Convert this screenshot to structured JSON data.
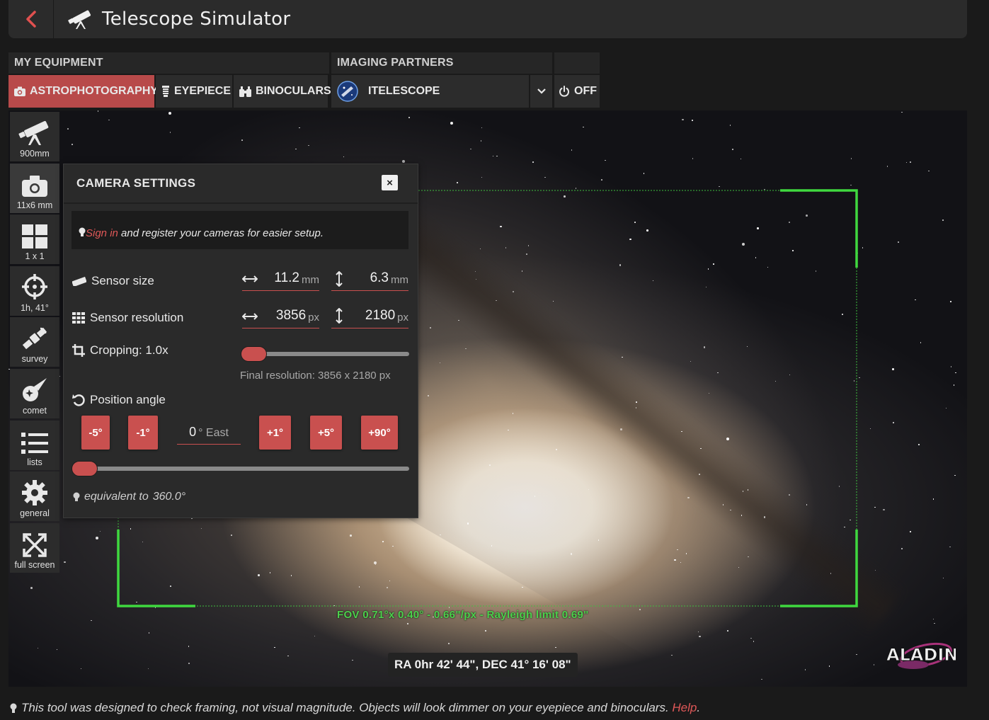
{
  "header": {
    "title": "Telescope Simulator",
    "back_icon": "chevron-left-icon",
    "app_icon": "telescope-icon",
    "accent": "#d9534f"
  },
  "equipment": {
    "my_equipment_label": "MY EQUIPMENT",
    "partners_label": "IMAGING PARTNERS",
    "tabs": [
      {
        "label": "ASTROPHOTOGRAPHY",
        "icon": "camera-icon",
        "active": true
      },
      {
        "label": "EYEPIECE",
        "icon": "eyepiece-icon",
        "active": false
      },
      {
        "label": "BINOCULARS",
        "icon": "binoculars-icon",
        "active": false
      }
    ],
    "partner": {
      "label": "ITELESCOPE",
      "icon": "itelescope-logo"
    },
    "off_label": "OFF"
  },
  "tools": [
    {
      "label": "900mm",
      "icon": "telescope-icon"
    },
    {
      "label": "11x6 mm",
      "icon": "camera-icon"
    },
    {
      "label": "1 x 1",
      "icon": "grid-icon"
    },
    {
      "label": "1h, 41°",
      "icon": "crosshair-icon"
    },
    {
      "label": "survey",
      "icon": "satellite-icon"
    },
    {
      "label": "comet",
      "icon": "comet-icon"
    },
    {
      "label": "lists",
      "icon": "list-icon"
    },
    {
      "label": "general",
      "icon": "gear-icon"
    },
    {
      "label": "full screen",
      "icon": "fullscreen-icon"
    }
  ],
  "camera_panel": {
    "title": "CAMERA SETTINGS",
    "close": "×",
    "signin_link": "Sign in",
    "signin_text": " and register your cameras for easier setup.",
    "sensor_size": {
      "label": "Sensor size",
      "width": "11.2",
      "height": "6.3",
      "unit": "mm"
    },
    "sensor_resolution": {
      "label": "Sensor resolution",
      "width": "3856",
      "height": "2180",
      "unit": "px"
    },
    "cropping": {
      "label": "Cropping: 1.0x",
      "value": 1.0
    },
    "final_resolution": "Final resolution: 3856 x 2180 px",
    "position_angle": {
      "label": "Position angle",
      "buttons": [
        "-5°",
        "-1°",
        "+1°",
        "+5°",
        "+90°"
      ],
      "value": "0",
      "unit": "° East",
      "slider_value": 0
    },
    "equivalent_prefix": "equivalent to",
    "equivalent_value": "360.0°"
  },
  "sky": {
    "fov_text": "FOV 0.71°x 0.40° - 0.66\"/px - Rayleigh limit 0.69\"",
    "radec": "RA 0hr 42' 44\", DEC 41° 16' 08\"",
    "aladin_logo": "ALADIN"
  },
  "footer": {
    "text": "This tool was designed to check framing, not visual magnitude. Objects will look dimmer on your eyepiece and binoculars. ",
    "help_link": "Help",
    "period": "."
  }
}
